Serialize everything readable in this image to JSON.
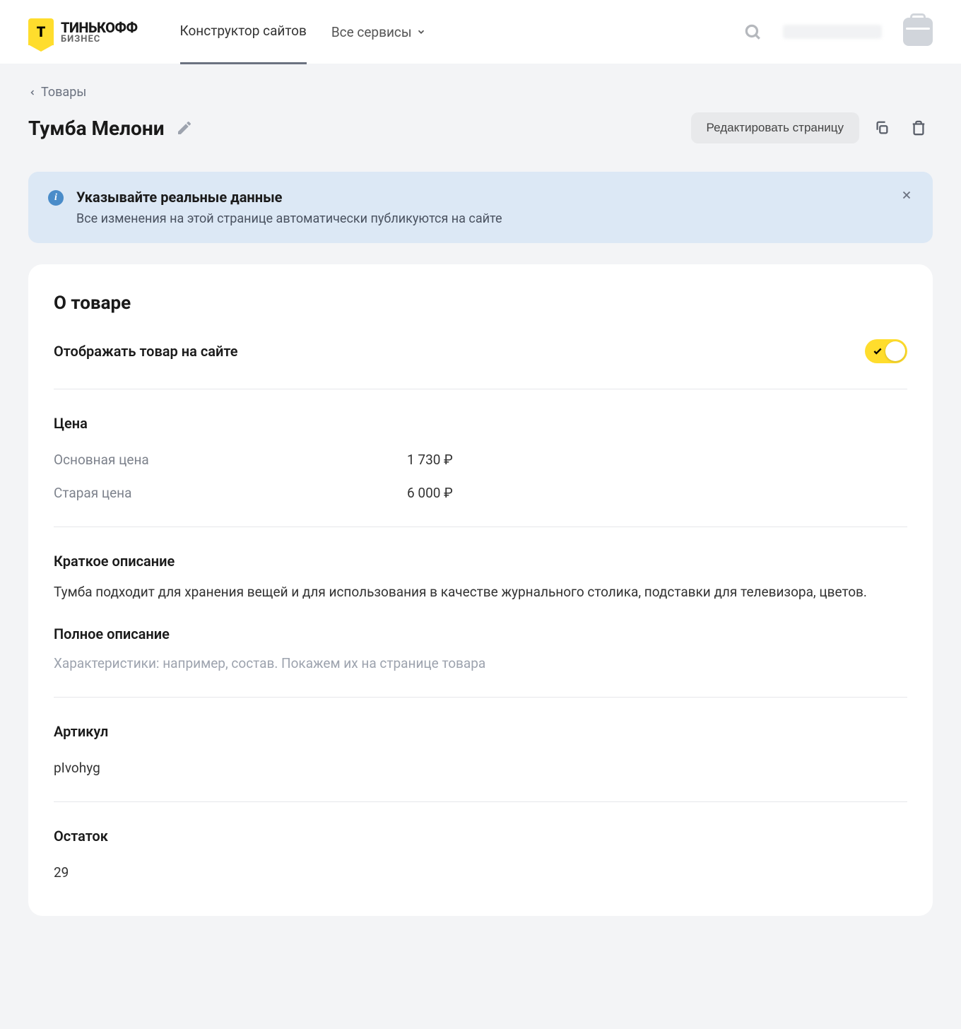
{
  "logo": {
    "main": "ТИНЬКОФФ",
    "sub": "БИЗНЕС",
    "letter": "Т"
  },
  "nav": {
    "site_builder": "Конструктор сайтов",
    "all_services": "Все сервисы"
  },
  "breadcrumb": {
    "label": "Товары"
  },
  "page": {
    "title": "Тумба Мелони",
    "edit_page_btn": "Редактировать страницу"
  },
  "banner": {
    "title": "Указывайте реальные данные",
    "desc": "Все изменения на этой странице автоматически публикуются на сайте"
  },
  "product": {
    "section_title": "О товаре",
    "visibility_label": "Отображать товар на сайте",
    "visibility_on": true,
    "price": {
      "heading": "Цена",
      "main_label": "Основная цена",
      "main_value": "1 730 ₽",
      "old_label": "Старая цена",
      "old_value": "6 000 ₽"
    },
    "short_desc": {
      "label": "Краткое описание",
      "text": "Тумба подходит для хранения вещей и для использования в качестве журнального столика, подставки для телевизора, цветов."
    },
    "full_desc": {
      "label": "Полное описание",
      "placeholder": "Характеристики: например, состав. Покажем их на странице товара"
    },
    "sku": {
      "label": "Артикул",
      "value": "pIvohyg"
    },
    "stock": {
      "label": "Остаток",
      "value": "29"
    }
  }
}
